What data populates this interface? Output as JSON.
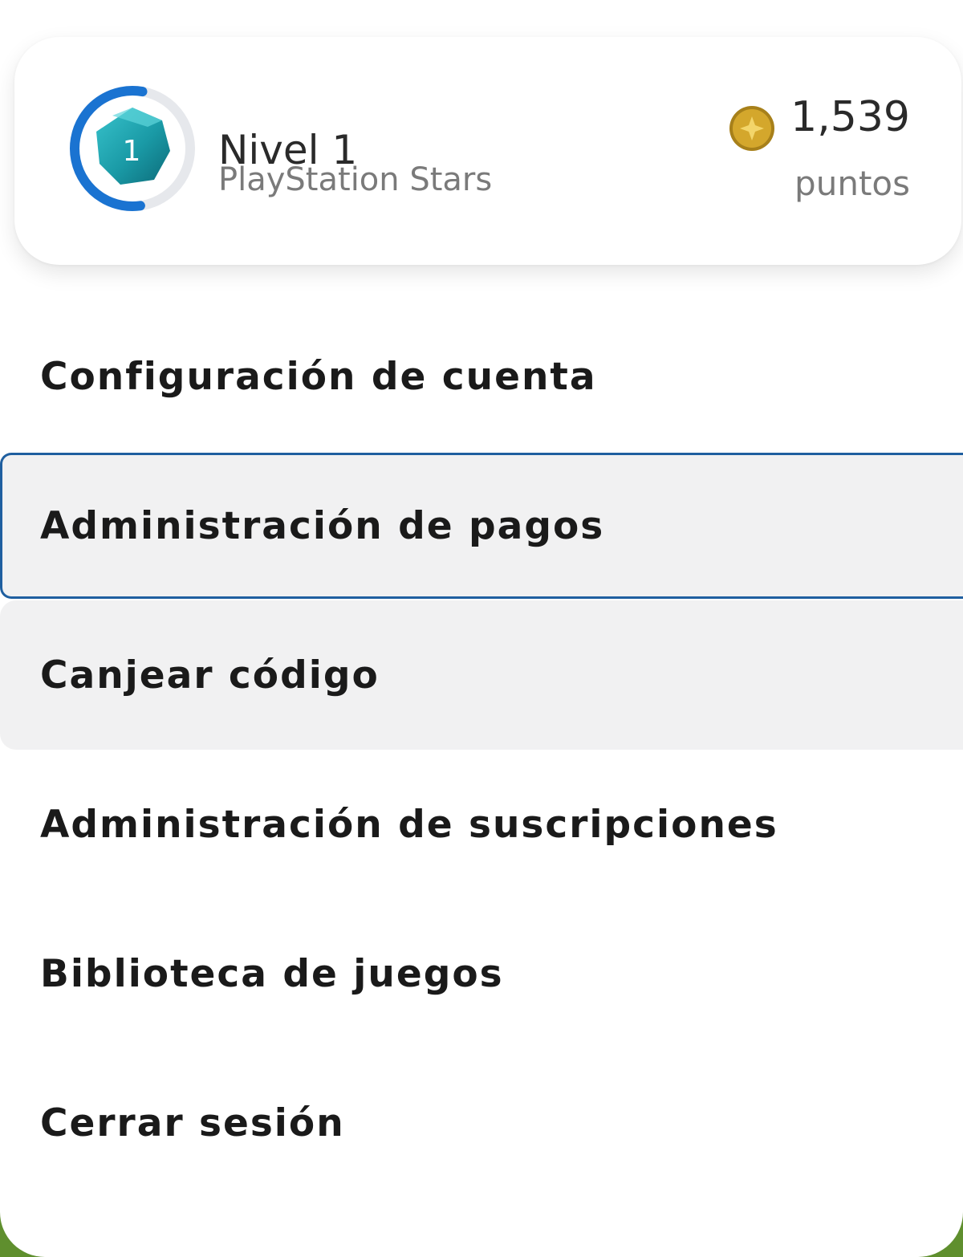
{
  "stars": {
    "level_number": "1",
    "level_title": "Nivel 1",
    "program_name": "PlayStation Stars",
    "level_progress": 0.55,
    "points_value": "1,539",
    "points_label": "puntos",
    "colors": {
      "ring_progress": "#1a73d1",
      "ring_track": "#e6e8ec",
      "badge": "#1f9ea8",
      "coin": "#d4a72c"
    }
  },
  "menu": {
    "items": [
      {
        "label": "Configuración de cuenta",
        "state": "normal"
      },
      {
        "label": "Administración de pagos",
        "state": "focused"
      },
      {
        "label": "Canjear código",
        "state": "hovered"
      },
      {
        "label": "Administración de suscripciones",
        "state": "normal"
      },
      {
        "label": "Biblioteca de juegos",
        "state": "normal"
      },
      {
        "label": "Cerrar sesión",
        "state": "normal"
      }
    ]
  },
  "colors": {
    "focus_outline": "#1f5fa0",
    "highlight_bg": "#f1f1f2",
    "background_green": "#5f8f2e"
  }
}
